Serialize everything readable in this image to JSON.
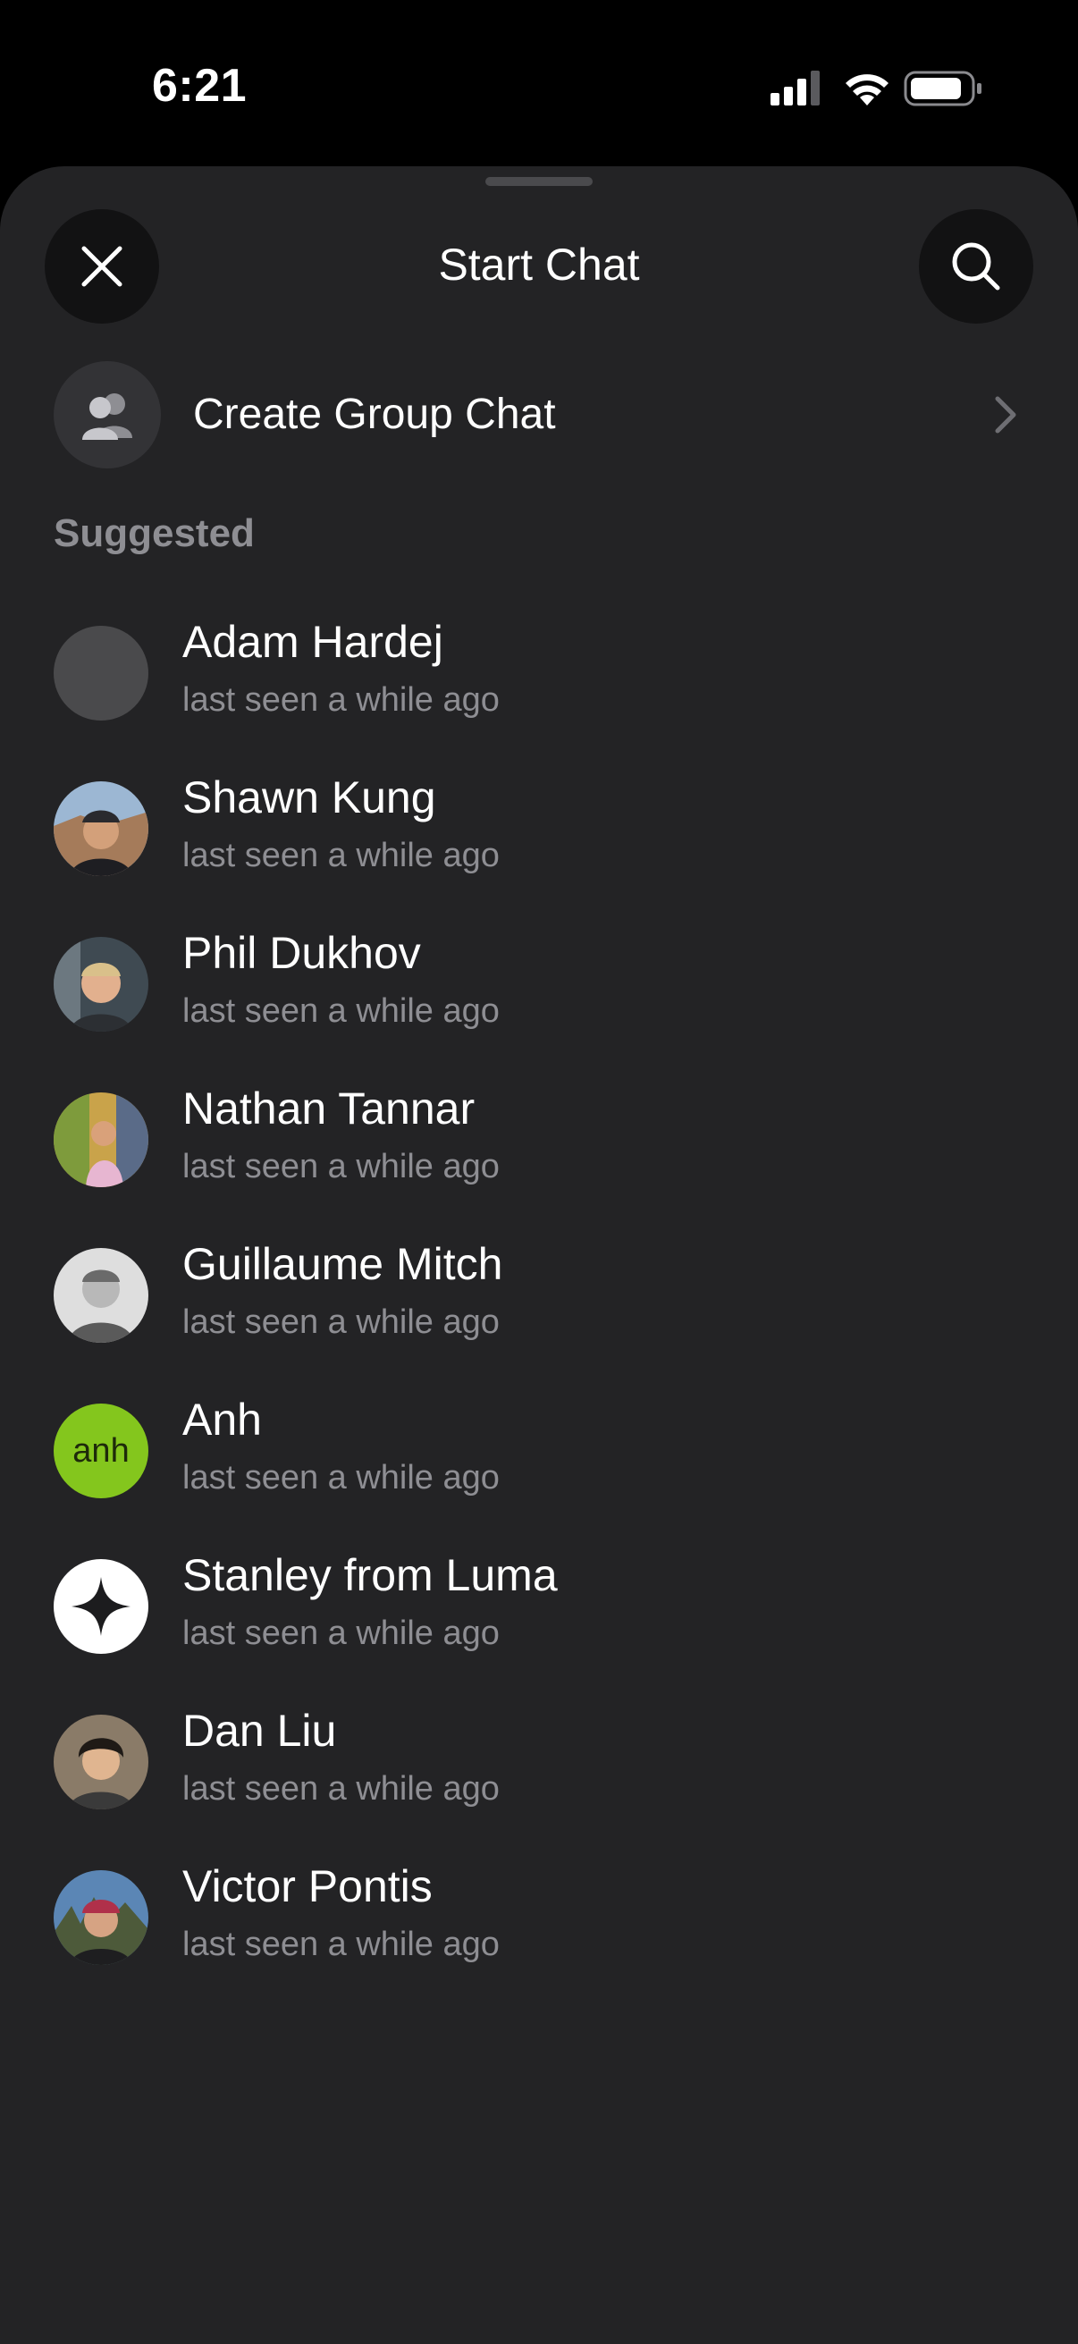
{
  "status_bar": {
    "time": "6:21",
    "icons": [
      "cellular-signal-icon",
      "wifi-icon",
      "battery-icon"
    ]
  },
  "header": {
    "title": "Start Chat",
    "close_icon": "close-icon",
    "search_icon": "search-icon"
  },
  "create_group": {
    "label": "Create Group Chat",
    "icon": "group-icon"
  },
  "section": {
    "label": "Suggested"
  },
  "contacts": [
    {
      "name": "Adam Hardej",
      "status": "last seen a while ago",
      "avatar_color": "#4a4a4c"
    },
    {
      "name": "Shawn Kung",
      "status": "last seen a while ago",
      "avatar_color": "#8b6a4f"
    },
    {
      "name": "Phil Dukhov",
      "status": "last seen a while ago",
      "avatar_color": "#5e6a72"
    },
    {
      "name": "Nathan Tannar",
      "status": "last seen a while ago",
      "avatar_color": "#b98a5a"
    },
    {
      "name": "Guillaume Mitch",
      "status": "last seen a while ago",
      "avatar_color": "#bdbdbd"
    },
    {
      "name": "Anh",
      "status": "last seen a while ago",
      "avatar_color": "#84c61d",
      "avatar_text": "anh"
    },
    {
      "name": "Stanley from Luma",
      "status": "last seen a while ago",
      "avatar_color": "#ffffff"
    },
    {
      "name": "Dan Liu",
      "status": "last seen a while ago",
      "avatar_color": "#6d5a4a"
    },
    {
      "name": "Victor Pontis",
      "status": "last seen a while ago",
      "avatar_color": "#3c5a7a"
    }
  ],
  "colors": {
    "sheet_background": "#232325",
    "secondary_text": "#8e8e93",
    "button_background": "#121213"
  }
}
